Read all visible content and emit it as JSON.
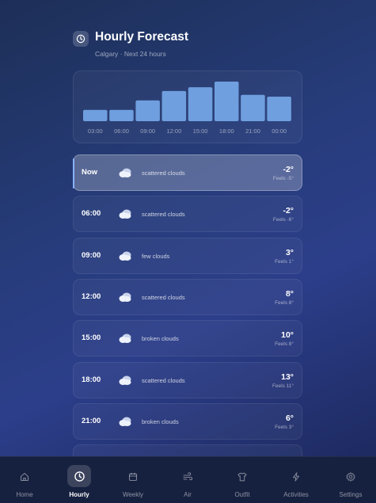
{
  "header": {
    "title": "Hourly Forecast",
    "subtitle": "Calgary · Next 24 hours",
    "icon": "clock-icon"
  },
  "chart_data": {
    "type": "bar",
    "categories": [
      "03:00",
      "06:00",
      "09:00",
      "12:00",
      "15:00",
      "18:00",
      "21:00",
      "00:00"
    ],
    "values": [
      -2,
      -2,
      3,
      8,
      10,
      13,
      6,
      5
    ],
    "tick_labels": [
      "03:00",
      "06:00",
      "09:00",
      "12:00",
      "15:00",
      "18:00",
      "21:00",
      "00:00"
    ],
    "ylim": [
      -8,
      13
    ],
    "title": "",
    "xlabel": "",
    "ylabel": "",
    "grid": false,
    "bar_color": "#6f9fdf"
  },
  "forecast": [
    {
      "time": "Now",
      "icon": "cloud-icon",
      "condition": "scattered clouds",
      "temp": "-2°",
      "feels": "Feels -5°",
      "active": true
    },
    {
      "time": "06:00",
      "icon": "cloud-icon",
      "condition": "scattered clouds",
      "temp": "-2°",
      "feels": "Feels -6°",
      "active": false
    },
    {
      "time": "09:00",
      "icon": "cloud-icon",
      "condition": "few clouds",
      "temp": "3°",
      "feels": "Feels 1°",
      "active": false
    },
    {
      "time": "12:00",
      "icon": "cloud-icon",
      "condition": "scattered clouds",
      "temp": "8°",
      "feels": "Feels 8°",
      "active": false
    },
    {
      "time": "15:00",
      "icon": "cloud-icon",
      "condition": "broken clouds",
      "temp": "10°",
      "feels": "Feels 8°",
      "active": false
    },
    {
      "time": "18:00",
      "icon": "cloud-icon",
      "condition": "scattered clouds",
      "temp": "13°",
      "feels": "Feels 11°",
      "active": false
    },
    {
      "time": "21:00",
      "icon": "cloud-icon",
      "condition": "broken clouds",
      "temp": "6°",
      "feels": "Feels 3°",
      "active": false
    }
  ],
  "nav": [
    {
      "label": "Home",
      "icon": "home-icon",
      "active": false
    },
    {
      "label": "Hourly",
      "icon": "clock-icon",
      "active": true
    },
    {
      "label": "Weekly",
      "icon": "calendar-icon",
      "active": false
    },
    {
      "label": "Air",
      "icon": "wind-icon",
      "active": false
    },
    {
      "label": "Outfit",
      "icon": "shirt-icon",
      "active": false
    },
    {
      "label": "Activities",
      "icon": "lightning-icon",
      "active": false
    },
    {
      "label": "Settings",
      "icon": "gear-icon",
      "active": false
    }
  ],
  "colors": {
    "accent": "#8ab2ff",
    "bar": "#6f9fdf",
    "nav_bg": "#16203f"
  }
}
